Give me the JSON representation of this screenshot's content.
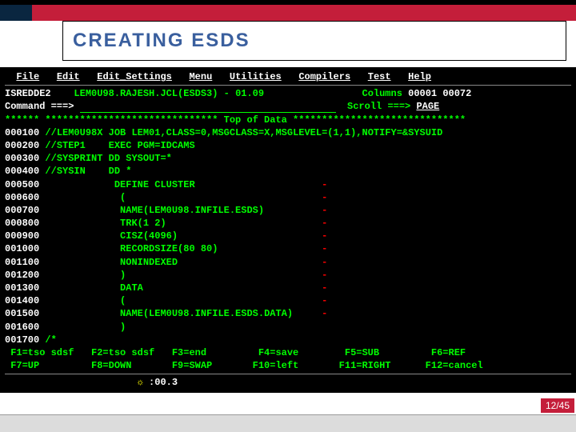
{
  "slide": {
    "title": "CREATING ESDS",
    "page": "12/45"
  },
  "menubar": {
    "file": "File",
    "edit": "Edit",
    "edit_settings": "Edit_Settings",
    "menu": "Menu",
    "utilities": "Utilities",
    "compilers": "Compilers",
    "test": "Test",
    "help": "Help"
  },
  "header": {
    "program": "ISREDDE2",
    "dataset": "LEM0U98.RAJESH.JCL(ESDS3)",
    "sep": "-",
    "ver": "01.09",
    "cols_label": "Columns",
    "cols_val": "00001 00072",
    "cmd_label": "Command ===>",
    "scroll_label": "Scroll ===>",
    "scroll_val": "PAGE",
    "top": "****** ****************************** Top of Data ******************************"
  },
  "lines": [
    {
      "num": "000100",
      "text": "//LEM0U98X JOB LEM01,CLASS=0,MSGCLASS=X,MSGLEVEL=(1,1),NOTIFY=&SYSUID",
      "dash": ""
    },
    {
      "num": "000200",
      "text": "//STEP1    EXEC PGM=IDCAMS",
      "dash": ""
    },
    {
      "num": "000300",
      "text": "//SYSPRINT DD SYSOUT=*",
      "dash": ""
    },
    {
      "num": "000400",
      "text": "//SYSIN    DD *",
      "dash": ""
    },
    {
      "num": "000500",
      "text": "            DEFINE CLUSTER",
      "dash": "-"
    },
    {
      "num": "000600",
      "text": "             (",
      "dash": "-"
    },
    {
      "num": "000700",
      "text": "             NAME(LEM0U98.INFILE.ESDS)",
      "dash": "-"
    },
    {
      "num": "000800",
      "text": "             TRK(1 2)",
      "dash": "-"
    },
    {
      "num": "000900",
      "text": "             CISZ(4096)",
      "dash": "-"
    },
    {
      "num": "001000",
      "text": "             RECORDSIZE(80 80)",
      "dash": "-"
    },
    {
      "num": "001100",
      "text": "             NONINDEXED",
      "dash": "-"
    },
    {
      "num": "001200",
      "text": "             )",
      "dash": "-"
    },
    {
      "num": "001300",
      "text": "             DATA",
      "dash": "-"
    },
    {
      "num": "001400",
      "text": "             (",
      "dash": "-"
    },
    {
      "num": "001500",
      "text": "             NAME(LEM0U98.INFILE.ESDS.DATA)",
      "dash": "-"
    },
    {
      "num": "001600",
      "text": "             )",
      "dash": ""
    },
    {
      "num": "001700",
      "text": "/*",
      "dash": ""
    }
  ],
  "fkeys": {
    "r1": " F1=tso sdsf   F2=tso sdsf   F3=end         F4=save        F5=SUB         F6=REF",
    "r2": " F7=UP         F8=DOWN       F9=SWAP       F10=left       F11=RIGHT      F12=cancel"
  },
  "status": {
    "time": ":00.3"
  }
}
